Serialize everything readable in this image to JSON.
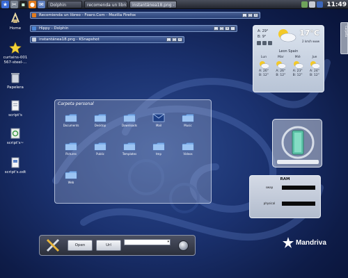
{
  "taskbar": {
    "tasks": [
      "Dolphin",
      "recomenda un libro ...",
      "instantánea18.png - ..."
    ],
    "clock": "11:49"
  },
  "desktop_icons": [
    {
      "label": "Home",
      "icon": "home-icon"
    },
    {
      "label": "curtains-001 567-steel-...",
      "icon": "star-icon"
    },
    {
      "label": "Papelera",
      "icon": "trash-icon"
    },
    {
      "label": "script's",
      "icon": "document-icon"
    },
    {
      "label": "script's~",
      "icon": "recycle-icon"
    },
    {
      "label": "script's.odt",
      "icon": "odt-document-icon"
    }
  ],
  "windows": [
    {
      "title": "Recomienda un libreo - Foaro.Com - Mozilla Firefox"
    },
    {
      "title": "Hippy - Dolphin"
    },
    {
      "title": "instantánea18.png - KSnapshot"
    }
  ],
  "weather": {
    "high": "A: 29°",
    "low": "B: 9°",
    "current": "17°C",
    "wind": "2 km/h www",
    "city": "Leon Spain",
    "days": [
      {
        "name": "Lun",
        "high": "A: 26°",
        "low": "B: 12°"
      },
      {
        "name": "Mar",
        "high": "A: 26°",
        "low": "B: 12°"
      },
      {
        "name": "Mié",
        "high": "A: 23°",
        "low": "B: 12°"
      },
      {
        "name": "Jue",
        "high": "A: 24°",
        "low": "B: 12°"
      }
    ]
  },
  "sidetab": {
    "label": "Carpeta"
  },
  "folderview": {
    "title": "Carpeta personal",
    "items": [
      {
        "label": "Documents",
        "type": "folder"
      },
      {
        "label": "Desktop",
        "type": "folder"
      },
      {
        "label": "Downloads",
        "type": "folder"
      },
      {
        "label": "Mail",
        "type": "mail"
      },
      {
        "label": "Music",
        "type": "folder"
      },
      {
        "label": "Pictures",
        "type": "folder"
      },
      {
        "label": "Public",
        "type": "folder"
      },
      {
        "label": "Templates",
        "type": "folder"
      },
      {
        "label": "tmp",
        "type": "folder"
      },
      {
        "label": "Videos",
        "type": "folder"
      },
      {
        "label": "Web",
        "type": "folder"
      }
    ]
  },
  "ram": {
    "title": "RAM",
    "rows": [
      {
        "label": "swap"
      },
      {
        "label": "physical"
      }
    ]
  },
  "launcher": {
    "open_label": "Open",
    "url_label": "Url",
    "combo_value": ""
  },
  "logo": {
    "name": "Mandriva"
  }
}
